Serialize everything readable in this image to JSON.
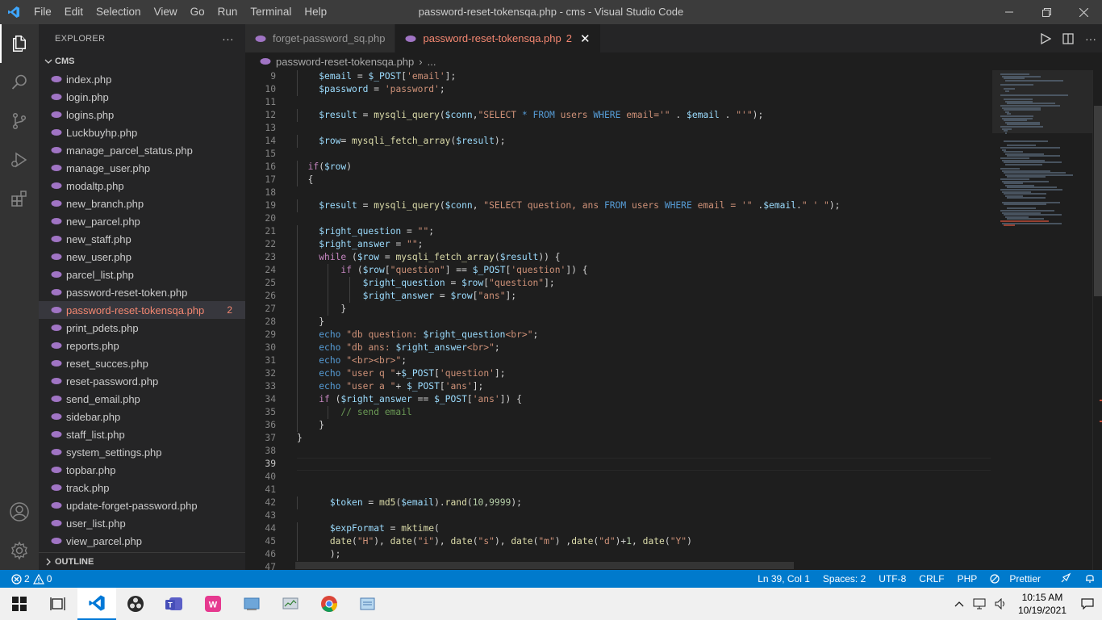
{
  "titlebar": {
    "menu": [
      "File",
      "Edit",
      "Selection",
      "View",
      "Go",
      "Run",
      "Terminal",
      "Help"
    ],
    "window_title": "password-reset-tokensqa.php - cms - Visual Studio Code"
  },
  "explorer": {
    "header": "EXPLORER",
    "more": "···",
    "folder": "CMS",
    "files": [
      {
        "name": "index.php"
      },
      {
        "name": "login.php"
      },
      {
        "name": "logins.php"
      },
      {
        "name": "Luckbuyhp.php"
      },
      {
        "name": "manage_parcel_status.php"
      },
      {
        "name": "manage_user.php"
      },
      {
        "name": "modaltp.php"
      },
      {
        "name": "new_branch.php"
      },
      {
        "name": "new_parcel.php"
      },
      {
        "name": "new_staff.php"
      },
      {
        "name": "new_user.php"
      },
      {
        "name": "parcel_list.php"
      },
      {
        "name": "password-reset-token.php"
      },
      {
        "name": "password-reset-tokensqa.php",
        "badge": "2",
        "selected": true
      },
      {
        "name": "print_pdets.php"
      },
      {
        "name": "reports.php"
      },
      {
        "name": "reset_succes.php"
      },
      {
        "name": "reset-password.php"
      },
      {
        "name": "send_email.php"
      },
      {
        "name": "sidebar.php"
      },
      {
        "name": "staff_list.php"
      },
      {
        "name": "system_settings.php"
      },
      {
        "name": "topbar.php"
      },
      {
        "name": "track.php"
      },
      {
        "name": "update-forget-password.php"
      },
      {
        "name": "user_list.php"
      },
      {
        "name": "view_parcel.php"
      }
    ],
    "outline": "OUTLINE"
  },
  "tabs": [
    {
      "label": "forget-password_sq.php",
      "active": false
    },
    {
      "label": "password-reset-tokensqa.php",
      "badge": "2",
      "active": true,
      "close": "✕"
    }
  ],
  "breadcrumb": {
    "file": "password-reset-tokensqa.php",
    "sep": "›",
    "rest": "..."
  },
  "editor": {
    "current_line": 39,
    "lines": [
      {
        "n": "9",
        "indent": 2,
        "tokens": [
          [
            "v",
            "$email"
          ],
          [
            "p",
            " = "
          ],
          [
            "v",
            "$_POST"
          ],
          [
            "p",
            "["
          ],
          [
            "s",
            "'email'"
          ],
          [
            "p",
            "];"
          ]
        ]
      },
      {
        "n": "10",
        "indent": 2,
        "tokens": [
          [
            "v",
            "$password"
          ],
          [
            "p",
            " = "
          ],
          [
            "s",
            "'password'"
          ],
          [
            "p",
            ";"
          ]
        ]
      },
      {
        "n": "11",
        "indent": 0,
        "tokens": []
      },
      {
        "n": "12",
        "indent": 2,
        "tokens": [
          [
            "v",
            "$result"
          ],
          [
            "p",
            " = "
          ],
          [
            "f",
            "mysqli_query"
          ],
          [
            "p",
            "("
          ],
          [
            "v",
            "$conn"
          ],
          [
            "p",
            ","
          ],
          [
            "s",
            "\"SELECT "
          ],
          [
            "k",
            "*"
          ],
          [
            "s",
            " "
          ],
          [
            "k",
            "FROM"
          ],
          [
            "s",
            " users "
          ],
          [
            "k",
            "WHERE"
          ],
          [
            "s",
            " email='\""
          ],
          [
            "p",
            " . "
          ],
          [
            "v",
            "$email"
          ],
          [
            "p",
            " . "
          ],
          [
            "s",
            "\"'\""
          ],
          [
            "p",
            ");"
          ]
        ]
      },
      {
        "n": "13",
        "indent": 0,
        "tokens": []
      },
      {
        "n": "14",
        "indent": 2,
        "tokens": [
          [
            "v",
            "$row"
          ],
          [
            "p",
            "= "
          ],
          [
            "f",
            "mysqli_fetch_array"
          ],
          [
            "p",
            "("
          ],
          [
            "v",
            "$result"
          ],
          [
            "p",
            ");"
          ]
        ]
      },
      {
        "n": "15",
        "indent": 0,
        "tokens": []
      },
      {
        "n": "16",
        "indent": 1,
        "tokens": [
          [
            "kw2",
            "if"
          ],
          [
            "p",
            "("
          ],
          [
            "v",
            "$row"
          ],
          [
            "p",
            ")"
          ]
        ]
      },
      {
        "n": "17",
        "indent": 1,
        "tokens": [
          [
            "p",
            "{"
          ]
        ]
      },
      {
        "n": "18",
        "indent": 0,
        "tokens": []
      },
      {
        "n": "19",
        "indent": 2,
        "tokens": [
          [
            "v",
            "$result"
          ],
          [
            "p",
            " = "
          ],
          [
            "f",
            "mysqli_query"
          ],
          [
            "p",
            "("
          ],
          [
            "v",
            "$conn"
          ],
          [
            "p",
            ", "
          ],
          [
            "s",
            "\"SELECT question, ans "
          ],
          [
            "k",
            "FROM"
          ],
          [
            "s",
            " users "
          ],
          [
            "k",
            "WHERE"
          ],
          [
            "s",
            " email = '\""
          ],
          [
            "p",
            " ."
          ],
          [
            "v",
            "$email"
          ],
          [
            "p",
            "."
          ],
          [
            "s",
            "\" ' \""
          ],
          [
            "p",
            ");"
          ]
        ]
      },
      {
        "n": "20",
        "indent": 0,
        "tokens": []
      },
      {
        "n": "21",
        "indent": 2,
        "tokens": [
          [
            "v",
            "$right_question"
          ],
          [
            "p",
            " = "
          ],
          [
            "s",
            "\"\""
          ],
          [
            "p",
            ";"
          ]
        ]
      },
      {
        "n": "22",
        "indent": 2,
        "tokens": [
          [
            "v",
            "$right_answer"
          ],
          [
            "p",
            " = "
          ],
          [
            "s",
            "\"\""
          ],
          [
            "p",
            ";"
          ]
        ]
      },
      {
        "n": "23",
        "indent": 2,
        "tokens": [
          [
            "kw2",
            "while"
          ],
          [
            "p",
            " ("
          ],
          [
            "v",
            "$row"
          ],
          [
            "p",
            " = "
          ],
          [
            "f",
            "mysqli_fetch_array"
          ],
          [
            "p",
            "("
          ],
          [
            "v",
            "$result"
          ],
          [
            "p",
            ")) {"
          ]
        ]
      },
      {
        "n": "24",
        "indent": 4,
        "tokens": [
          [
            "kw2",
            "if"
          ],
          [
            "p",
            " ("
          ],
          [
            "v",
            "$row"
          ],
          [
            "p",
            "["
          ],
          [
            "s",
            "\"question\""
          ],
          [
            "p",
            "] == "
          ],
          [
            "v",
            "$_POST"
          ],
          [
            "p",
            "["
          ],
          [
            "s",
            "'question'"
          ],
          [
            "p",
            "]) {"
          ]
        ]
      },
      {
        "n": "25",
        "indent": 6,
        "tokens": [
          [
            "v",
            "$right_question"
          ],
          [
            "p",
            " = "
          ],
          [
            "v",
            "$row"
          ],
          [
            "p",
            "["
          ],
          [
            "s",
            "\"question\""
          ],
          [
            "p",
            "];"
          ]
        ]
      },
      {
        "n": "26",
        "indent": 6,
        "tokens": [
          [
            "v",
            "$right_answer"
          ],
          [
            "p",
            " = "
          ],
          [
            "v",
            "$row"
          ],
          [
            "p",
            "["
          ],
          [
            "s",
            "\"ans\""
          ],
          [
            "p",
            "];"
          ]
        ]
      },
      {
        "n": "27",
        "indent": 4,
        "tokens": [
          [
            "p",
            "}"
          ]
        ]
      },
      {
        "n": "28",
        "indent": 2,
        "tokens": [
          [
            "p",
            "}"
          ]
        ]
      },
      {
        "n": "29",
        "indent": 2,
        "tokens": [
          [
            "k",
            "echo"
          ],
          [
            "p",
            " "
          ],
          [
            "s",
            "\"db question: "
          ],
          [
            "v",
            "$right_question"
          ],
          [
            "s",
            "<br>\""
          ],
          [
            "p",
            ";"
          ]
        ]
      },
      {
        "n": "30",
        "indent": 2,
        "tokens": [
          [
            "k",
            "echo"
          ],
          [
            "p",
            " "
          ],
          [
            "s",
            "\"db ans: "
          ],
          [
            "v",
            "$right_answer"
          ],
          [
            "s",
            "<br>\""
          ],
          [
            "p",
            ";"
          ]
        ]
      },
      {
        "n": "31",
        "indent": 2,
        "tokens": [
          [
            "k",
            "echo"
          ],
          [
            "p",
            " "
          ],
          [
            "s",
            "\"<br><br>\""
          ],
          [
            "p",
            ";"
          ]
        ]
      },
      {
        "n": "32",
        "indent": 2,
        "tokens": [
          [
            "k",
            "echo"
          ],
          [
            "p",
            " "
          ],
          [
            "s",
            "\"user q \""
          ],
          [
            "p",
            "+"
          ],
          [
            "v",
            "$_POST"
          ],
          [
            "p",
            "["
          ],
          [
            "s",
            "'question'"
          ],
          [
            "p",
            "];"
          ]
        ]
      },
      {
        "n": "33",
        "indent": 2,
        "tokens": [
          [
            "k",
            "echo"
          ],
          [
            "p",
            " "
          ],
          [
            "s",
            "\"user a \""
          ],
          [
            "p",
            "+ "
          ],
          [
            "v",
            "$_POST"
          ],
          [
            "p",
            "["
          ],
          [
            "s",
            "'ans'"
          ],
          [
            "p",
            "];"
          ]
        ]
      },
      {
        "n": "34",
        "indent": 2,
        "tokens": [
          [
            "kw2",
            "if"
          ],
          [
            "p",
            " ("
          ],
          [
            "v",
            "$right_answer"
          ],
          [
            "p",
            " == "
          ],
          [
            "v",
            "$_POST"
          ],
          [
            "p",
            "["
          ],
          [
            "s",
            "'ans'"
          ],
          [
            "p",
            "]) {"
          ]
        ]
      },
      {
        "n": "35",
        "indent": 4,
        "tokens": [
          [
            "c",
            "// send email"
          ]
        ]
      },
      {
        "n": "36",
        "indent": 2,
        "tokens": [
          [
            "p",
            "}"
          ]
        ]
      },
      {
        "n": "37",
        "indent": 0,
        "tokens": [
          [
            "p",
            "}"
          ]
        ]
      },
      {
        "n": "38",
        "indent": 0,
        "tokens": []
      },
      {
        "n": "39",
        "indent": 0,
        "tokens": []
      },
      {
        "n": "40",
        "indent": 0,
        "tokens": []
      },
      {
        "n": "41",
        "indent": 0,
        "tokens": []
      },
      {
        "n": "42",
        "indent": 3,
        "tokens": [
          [
            "v",
            "$token"
          ],
          [
            "p",
            " = "
          ],
          [
            "f",
            "md5"
          ],
          [
            "p",
            "("
          ],
          [
            "v",
            "$email"
          ],
          [
            "p",
            ")."
          ],
          [
            "f",
            "rand"
          ],
          [
            "p",
            "("
          ],
          [
            "n",
            "10"
          ],
          [
            "p",
            ","
          ],
          [
            "n",
            "9999"
          ],
          [
            "p",
            ");"
          ]
        ]
      },
      {
        "n": "43",
        "indent": 0,
        "tokens": []
      },
      {
        "n": "44",
        "indent": 3,
        "tokens": [
          [
            "v",
            "$expFormat"
          ],
          [
            "p",
            " = "
          ],
          [
            "f",
            "mktime"
          ],
          [
            "p",
            "("
          ]
        ]
      },
      {
        "n": "45",
        "indent": 3,
        "tokens": [
          [
            "f",
            "date"
          ],
          [
            "p",
            "("
          ],
          [
            "s",
            "\"H\""
          ],
          [
            "p",
            "), "
          ],
          [
            "f",
            "date"
          ],
          [
            "p",
            "("
          ],
          [
            "s",
            "\"i\""
          ],
          [
            "p",
            "), "
          ],
          [
            "f",
            "date"
          ],
          [
            "p",
            "("
          ],
          [
            "s",
            "\"s\""
          ],
          [
            "p",
            "), "
          ],
          [
            "f",
            "date"
          ],
          [
            "p",
            "("
          ],
          [
            "s",
            "\"m\""
          ],
          [
            "p",
            ") ,"
          ],
          [
            "f",
            "date"
          ],
          [
            "p",
            "("
          ],
          [
            "s",
            "\"d\""
          ],
          [
            "p",
            ")+"
          ],
          [
            "n",
            "1"
          ],
          [
            "p",
            ", "
          ],
          [
            "f",
            "date"
          ],
          [
            "p",
            "("
          ],
          [
            "s",
            "\"Y\""
          ],
          [
            "p",
            ")"
          ]
        ]
      },
      {
        "n": "46",
        "indent": 3,
        "tokens": [
          [
            "p",
            ");"
          ]
        ]
      },
      {
        "n": "47",
        "indent": 0,
        "tokens": []
      }
    ]
  },
  "statusbar": {
    "errors": "2",
    "warnings": "0",
    "position": "Ln 39, Col 1",
    "spaces": "Spaces: 2",
    "encoding": "UTF-8",
    "eol": "CRLF",
    "language": "PHP",
    "prettier": "Prettier"
  },
  "taskbar": {
    "time": "10:15 AM",
    "date": "10/19/2021"
  },
  "colors": {
    "accent": "#007acc",
    "error": "#f48771",
    "php_icon": "#a074c4"
  }
}
